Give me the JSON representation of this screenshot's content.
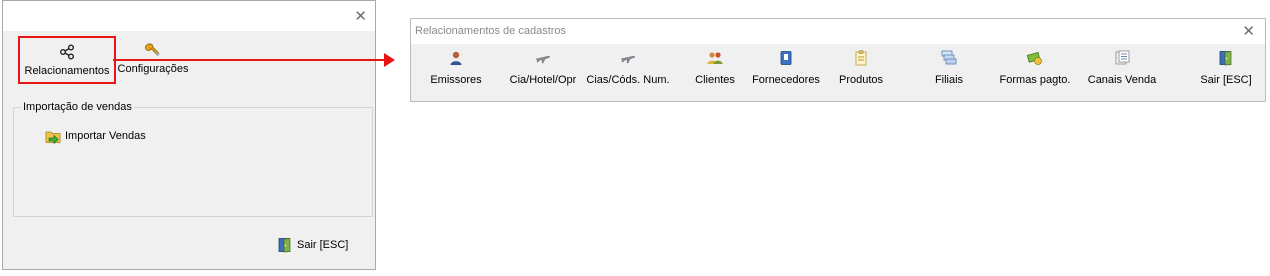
{
  "left_dialog": {
    "close_label": "✕",
    "toolbar": [
      {
        "label": "Relacionamentos",
        "icon": "share-icon"
      },
      {
        "label": "Configurações",
        "icon": "wrench-icon"
      }
    ],
    "group": {
      "title": "Importação de vendas",
      "items": [
        {
          "label": "Importar Vendas",
          "icon": "import-icon"
        }
      ]
    },
    "exit_label": "Sair [ESC]"
  },
  "right_window": {
    "title": "Relacionamentos de cadastros",
    "close_label": "✕",
    "buttons": [
      {
        "label": "Emissores",
        "icon": "person-icon"
      },
      {
        "label": "Cia/Hotel/Opr",
        "icon": "airplane-icon"
      },
      {
        "label": "Cias/Códs. Num.",
        "icon": "airplane-icon"
      },
      {
        "label": "Clientes",
        "icon": "people-icon"
      },
      {
        "label": "Fornecedores",
        "icon": "book-icon"
      },
      {
        "label": "Produtos",
        "icon": "clipboard-icon"
      },
      {
        "label": "Filiais",
        "icon": "stacked-windows-icon"
      },
      {
        "label": "Formas pagto.",
        "icon": "money-icon"
      },
      {
        "label": "Canais Venda",
        "icon": "document-grid-icon"
      },
      {
        "label": "Sair [ESC]",
        "icon": "exit-door-icon"
      }
    ]
  },
  "colors": {
    "highlight": "#e81515",
    "panel": "#f0f0f0",
    "title_text": "#8a8a8a"
  }
}
